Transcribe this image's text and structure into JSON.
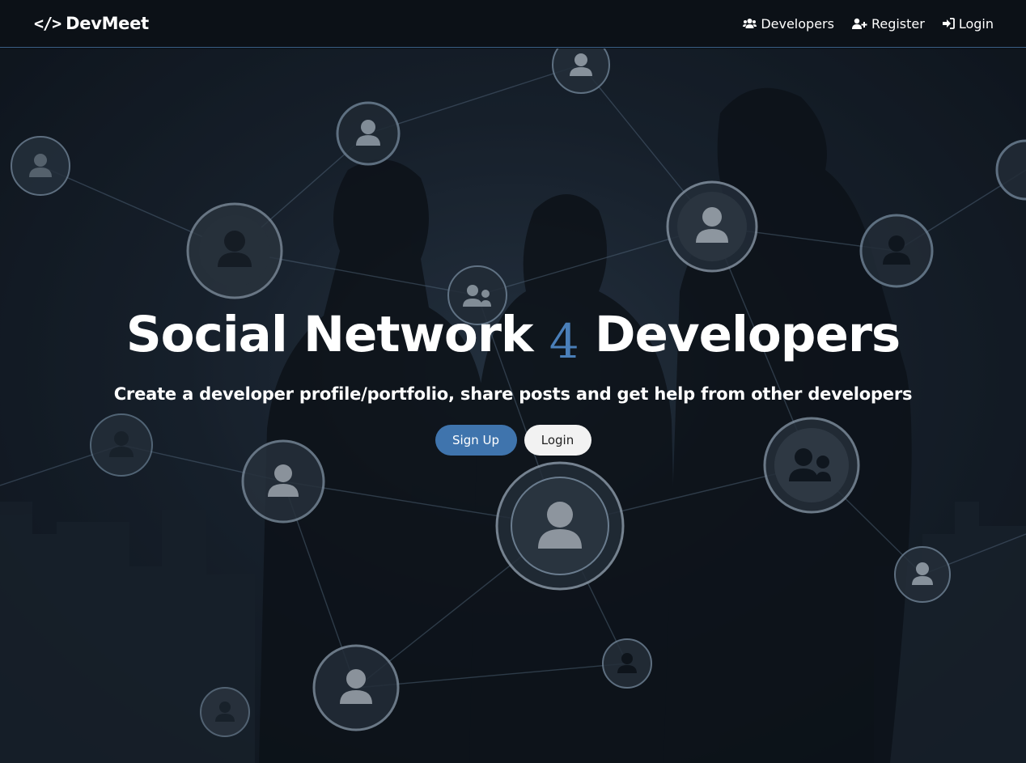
{
  "navbar": {
    "brand_icon": "</>",
    "brand": "DevMeet",
    "links": [
      {
        "label": "Developers",
        "icon": "users-icon"
      },
      {
        "label": "Register",
        "icon": "user-plus-icon"
      },
      {
        "label": "Login",
        "icon": "sign-in-icon"
      }
    ]
  },
  "hero": {
    "title_before": "Social Network ",
    "title_accent": "4",
    "title_after": " Developers",
    "lead": "Create a developer profile/portfolio, share posts and get help from other developers",
    "signup_label": "Sign Up",
    "login_label": "Login"
  },
  "colors": {
    "accent": "#4a7fb9",
    "primary_button": "#3f74ad",
    "navbar_bg": "#0c1117"
  }
}
